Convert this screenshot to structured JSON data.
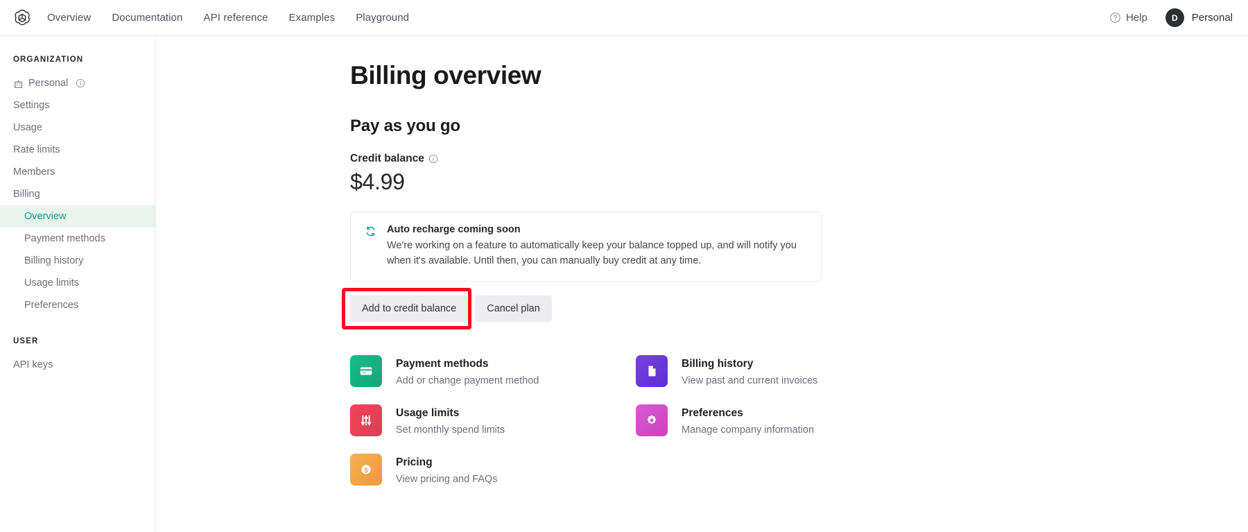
{
  "topnav": {
    "logo_icon": "openai-logo-icon",
    "links": [
      {
        "label": "Overview"
      },
      {
        "label": "Documentation"
      },
      {
        "label": "API reference"
      },
      {
        "label": "Examples"
      },
      {
        "label": "Playground"
      }
    ],
    "help_label": "Help",
    "help_icon": "question-circle-icon",
    "account": {
      "initial": "D",
      "name": "Personal"
    }
  },
  "sidebar": {
    "org_heading": "ORGANIZATION",
    "org_items": [
      {
        "label": "Personal",
        "icon": "building-icon",
        "trailing_icon": "info-circle-icon"
      },
      {
        "label": "Settings"
      },
      {
        "label": "Usage"
      },
      {
        "label": "Rate limits"
      },
      {
        "label": "Members"
      },
      {
        "label": "Billing"
      }
    ],
    "billing_sub_items": [
      {
        "label": "Overview",
        "active": true
      },
      {
        "label": "Payment methods",
        "active": false
      },
      {
        "label": "Billing history",
        "active": false
      },
      {
        "label": "Usage limits",
        "active": false
      },
      {
        "label": "Preferences",
        "active": false
      }
    ],
    "user_heading": "USER",
    "user_items": [
      {
        "label": "API keys"
      }
    ],
    "active_color": "#10a37f",
    "active_bg": "#e9f3ee"
  },
  "main": {
    "page_title": "Billing overview",
    "section_title": "Pay as you go",
    "credit_balance_label": "Credit balance",
    "credit_balance_info_icon": "info-circle-icon",
    "credit_balance_amount": "$4.99",
    "notice": {
      "icon": "refresh-cycle-icon",
      "icon_color": "#10a37f",
      "title": "Auto recharge coming soon",
      "body": "We're working on a feature to automatically keep your balance topped up, and will notify you when it's available. Until then, you can manually buy credit at any time."
    },
    "buttons": [
      {
        "label": "Add to credit balance",
        "highlighted": true
      },
      {
        "label": "Cancel plan",
        "highlighted": false
      }
    ],
    "highlight_color": "#f40f1f",
    "cards": [
      {
        "title": "Payment methods",
        "desc": "Add or change payment method",
        "icon": "credit-card-icon",
        "color_start": "#18bc86",
        "color_end": "#13a678"
      },
      {
        "title": "Billing history",
        "desc": "View past and current invoices",
        "icon": "document-icon",
        "color_start": "#7b3fe4",
        "color_end": "#5b2fd4"
      },
      {
        "title": "Usage limits",
        "desc": "Set monthly spend limits",
        "icon": "sliders-icon",
        "color_start": "#f0455c",
        "color_end": "#e23b50"
      },
      {
        "title": "Preferences",
        "desc": "Manage company information",
        "icon": "gear-icon",
        "color_start": "#d65bd6",
        "color_end": "#cf3fbd"
      },
      {
        "title": "Pricing",
        "desc": "View pricing and FAQs",
        "icon": "dollar-coin-icon",
        "color_start": "#f5b052",
        "color_end": "#ee9a3c"
      }
    ]
  }
}
